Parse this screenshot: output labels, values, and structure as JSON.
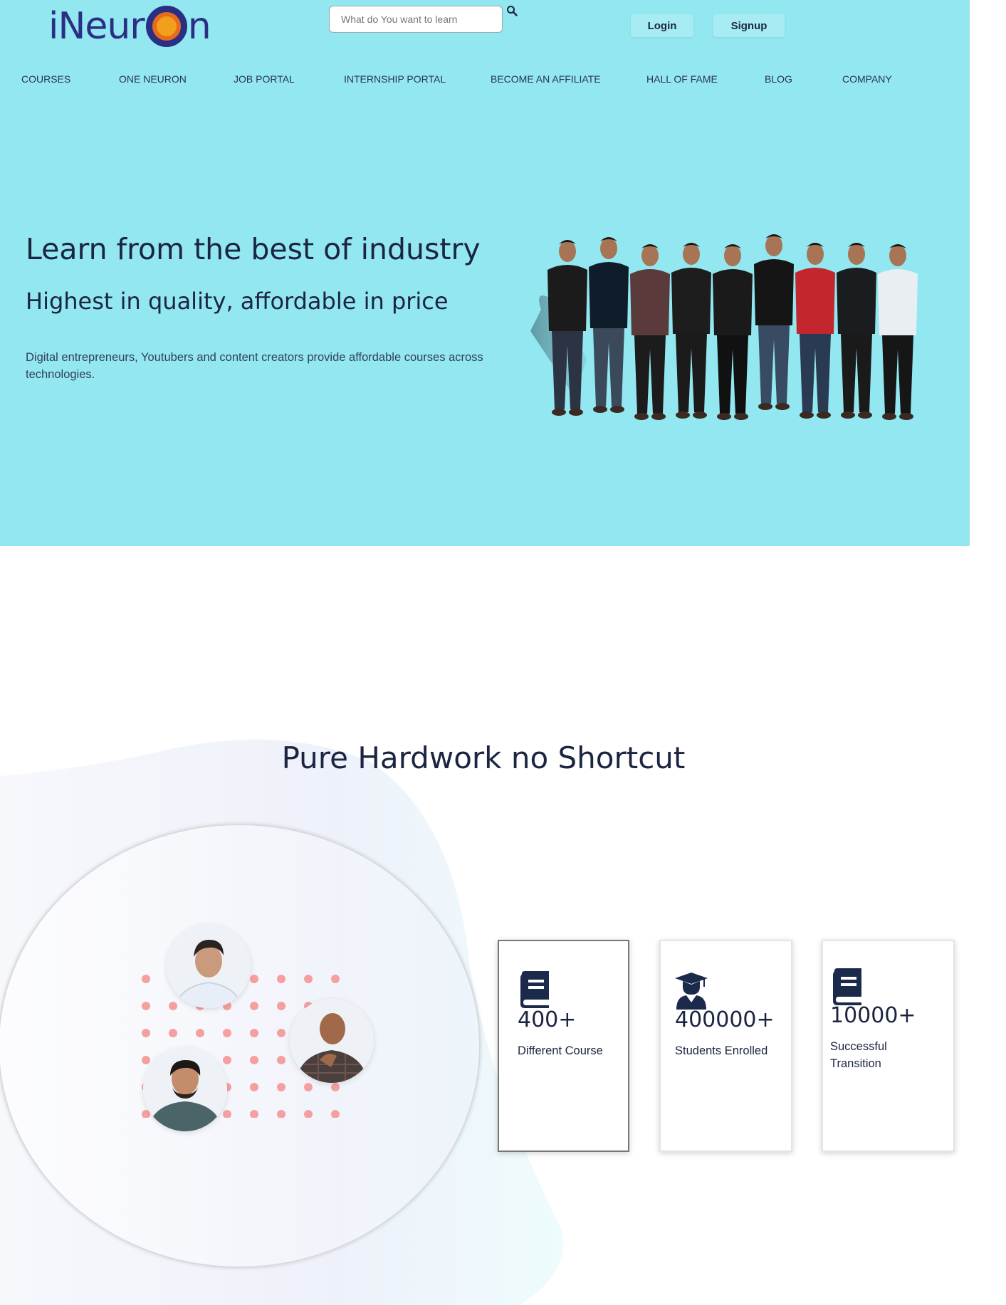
{
  "header": {
    "logo_text_left": "iNeur",
    "logo_text_right": "n",
    "search": {
      "placeholder": "What do You want to learn"
    },
    "login_label": "Login",
    "signup_label": "Signup"
  },
  "nav": {
    "items": [
      {
        "label": "COURSES"
      },
      {
        "label": "ONE NEURON"
      },
      {
        "label": "JOB PORTAL"
      },
      {
        "label": "INTERNSHIP PORTAL"
      },
      {
        "label": "BECOME AN AFFILIATE"
      },
      {
        "label": "HALL OF FAME"
      },
      {
        "label": "BLOG"
      },
      {
        "label": "COMPANY"
      }
    ]
  },
  "hero": {
    "title": "Learn from the best of industry",
    "subtitle": "Highest in quality, affordable in price",
    "description": "Digital entrepreneurs, Youtubers and content creators provide affordable courses across technologies."
  },
  "stats": {
    "title": "Pure Hardwork no Shortcut",
    "cards": [
      {
        "icon": "book-icon",
        "value": "400+",
        "label": "Different Course"
      },
      {
        "icon": "graduate-icon",
        "value": "400000+",
        "label": "Students Enrolled"
      },
      {
        "icon": "book-icon",
        "value": "10000+",
        "label": "Successful Transition"
      }
    ]
  },
  "colors": {
    "hero_bg": "#92e7f0",
    "text_dark": "#1b2440",
    "brand": "#2b2f83",
    "dot": "#f5a0a0",
    "button_bg": "#a8ecf3"
  }
}
